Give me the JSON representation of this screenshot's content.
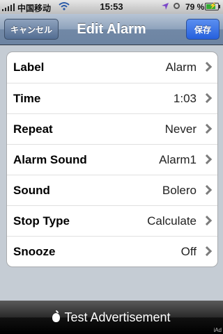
{
  "status_bar": {
    "carrier": "中国移动",
    "time": "15:53",
    "battery_percent": "79 %",
    "battery_level": 0.79
  },
  "nav": {
    "title": "Edit Alarm",
    "cancel_label": "キャンセル",
    "save_label": "保存"
  },
  "settings": [
    {
      "label": "Label",
      "value": "Alarm"
    },
    {
      "label": "Time",
      "value": "1:03"
    },
    {
      "label": "Repeat",
      "value": "Never"
    },
    {
      "label": "Alarm Sound",
      "value": "Alarm1"
    },
    {
      "label": "Sound",
      "value": "Bolero"
    },
    {
      "label": "Stop Type",
      "value": "Calculate"
    },
    {
      "label": "Snooze",
      "value": "Off"
    }
  ],
  "ad": {
    "text": "Test Advertisement",
    "corner_text": "iAd"
  },
  "colors": {
    "nav_gradient_bottom": "#6d84a2",
    "save_button": "#2660dd",
    "background": "#c5ccd4"
  }
}
